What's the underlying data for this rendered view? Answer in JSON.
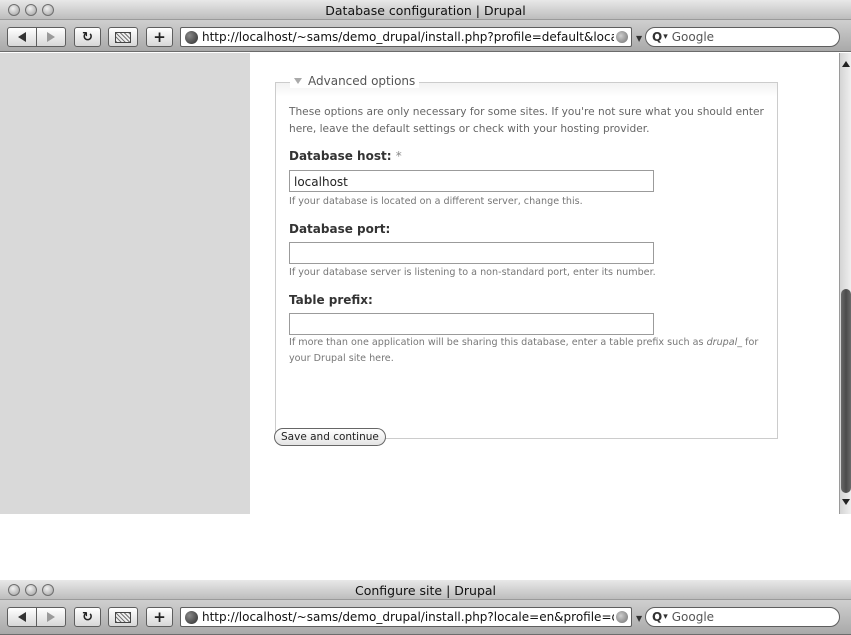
{
  "window1": {
    "title": "Database configuration | Drupal",
    "url": "http://localhost/~sams/demo_drupal/install.php?profile=default&local",
    "search_placeholder": "Google"
  },
  "form": {
    "legend": "Advanced options",
    "description": "These options are only necessary for some sites. If you're not sure what you should enter here, leave the default settings or check with your hosting provider.",
    "db_host": {
      "label": "Database host:",
      "required_mark": "*",
      "value": "localhost",
      "help": "If your database is located on a different server, change this."
    },
    "db_port": {
      "label": "Database port:",
      "value": "",
      "help": "If your database server is listening to a non-standard port, enter its number."
    },
    "table_prefix": {
      "label": "Table prefix:",
      "value": "",
      "help_before": "If more than one application will be sharing this database, enter a table prefix such as ",
      "help_em": "drupal_",
      "help_after": " for your Drupal site here."
    },
    "submit_label": "Save and continue"
  },
  "window2": {
    "title": "Configure site | Drupal",
    "url": "http://localhost/~sams/demo_drupal/install.php?locale=en&profile=defau",
    "search_placeholder": "Google"
  },
  "icons": {
    "back": "back-arrow-icon",
    "forward": "forward-arrow-icon",
    "reload": "reload-icon",
    "snapback": "snapback-icon",
    "add_bookmark": "plus-icon",
    "site": "globe-icon",
    "search": "magnifier-icon"
  }
}
